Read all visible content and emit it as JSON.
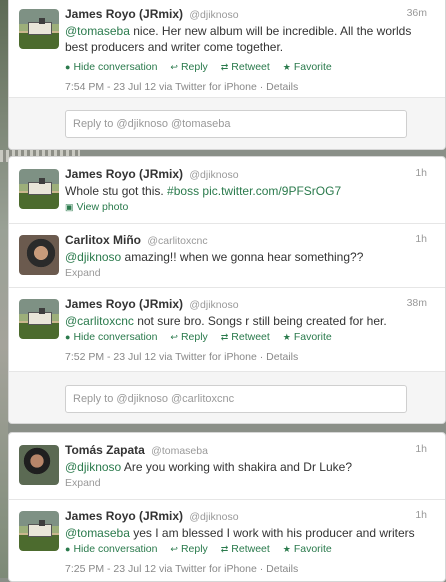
{
  "cards": [
    {
      "tweets": [
        {
          "name": "James Royo (JRmix)",
          "handle": "@djiknoso",
          "time": "36m",
          "avatar": "house-photo-avatar",
          "mention": "@tomaseba",
          "text": " nice. Her new album will be incredible. All the worlds best producers and writer come together.",
          "actions": {
            "hide": "Hide conversation",
            "reply": "Reply",
            "retweet": "Retweet",
            "favorite": "Favorite"
          },
          "meta": "7:54 PM - 23 Jul 12 via Twitter for iPhone · Details"
        }
      ],
      "reply_placeholder": "Reply to @djiknoso @tomaseba"
    },
    {
      "tweets": [
        {
          "name": "James Royo (JRmix)",
          "handle": "@djiknoso",
          "time": "1h",
          "avatar": "house-photo-avatar",
          "text_pre": "Whole stu got this. ",
          "hashtag": "#boss",
          "url": " pic.twitter.com/9PFSrOG7",
          "view_photo": "View photo"
        },
        {
          "name": "Carlitox Miño",
          "handle": "@carlitoxcnc",
          "time": "1h",
          "avatar": "person-photo-avatar",
          "mention": "@djiknoso",
          "text": " amazing!! when we gonna hear something??",
          "expand": "Expand"
        },
        {
          "name": "James Royo (JRmix)",
          "handle": "@djiknoso",
          "time": "38m",
          "avatar": "house-photo-avatar",
          "mention": "@carlitoxcnc",
          "text": " not sure bro. Songs r still being created for her.",
          "actions": {
            "hide": "Hide conversation",
            "reply": "Reply",
            "retweet": "Retweet",
            "favorite": "Favorite"
          },
          "meta": "7:52 PM - 23 Jul 12 via Twitter for iPhone · Details"
        }
      ],
      "reply_placeholder": "Reply to @djiknoso @carlitoxcnc"
    },
    {
      "tweets": [
        {
          "name": "Tomás Zapata",
          "handle": "@tomaseba",
          "time": "1h",
          "avatar": "person-photo-avatar",
          "mention": "@djiknoso",
          "text": " Are you working with shakira and Dr Luke?",
          "expand": "Expand"
        },
        {
          "name": "James Royo (JRmix)",
          "handle": "@djiknoso",
          "time": "1h",
          "avatar": "house-photo-avatar",
          "mention": "@tomaseba",
          "text": " yes I am blessed I work with his producer and writers",
          "actions": {
            "hide": "Hide conversation",
            "reply": "Reply",
            "retweet": "Retweet",
            "favorite": "Favorite"
          },
          "meta": "7:25 PM - 23 Jul 12 via Twitter for iPhone · Details"
        }
      ]
    }
  ],
  "colors": {
    "link": "#2a7a4c",
    "muted": "#999999",
    "text": "#333333",
    "page_bg": "#8a8f88"
  }
}
